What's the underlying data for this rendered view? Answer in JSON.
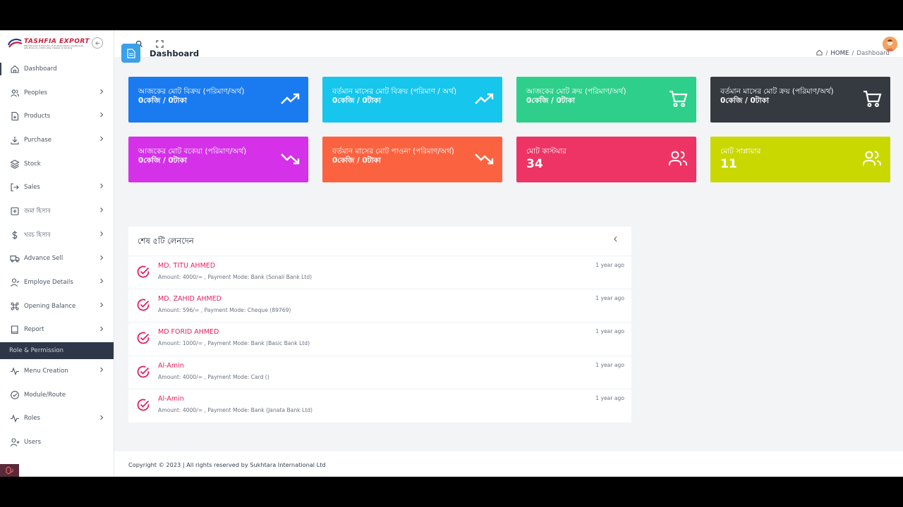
{
  "brand": {
    "name": "TASHFIA EXPORT",
    "tagline": "Manufacturer & Exporter of All Kinds Export Quality Jute, Jute Products, Cotton Jute, Hessian & Sacking"
  },
  "sidebar": {
    "items": [
      {
        "label": "Dashboard",
        "icon": "home-icon",
        "has_children": false,
        "active": true
      },
      {
        "label": "Peoples",
        "icon": "users-icon",
        "has_children": true
      },
      {
        "label": "Products",
        "icon": "file-plus-icon",
        "has_children": true
      },
      {
        "label": "Purchase",
        "icon": "download-icon",
        "has_children": true
      },
      {
        "label": "Stock",
        "icon": "layers-icon",
        "has_children": false
      },
      {
        "label": "Sales",
        "icon": "log-out-icon",
        "has_children": true
      },
      {
        "label": "জমা হিসাব",
        "icon": "plus-square-icon",
        "has_children": true
      },
      {
        "label": "খরচ হিসাব",
        "icon": "dollar-icon",
        "has_children": true
      },
      {
        "label": "Advance Sell",
        "icon": "truck-icon",
        "has_children": true
      },
      {
        "label": "Employe Details",
        "icon": "user-icon",
        "has_children": true
      },
      {
        "label": "Opening Balance",
        "icon": "command-icon",
        "has_children": true
      },
      {
        "label": "Report",
        "icon": "book-icon",
        "has_children": true
      }
    ],
    "section_header": "Role & Permission",
    "items2": [
      {
        "label": "Menu Creation",
        "icon": "activity-icon",
        "has_children": true
      },
      {
        "label": "Module/Route",
        "icon": "check-circle-icon",
        "has_children": false
      },
      {
        "label": "Roles",
        "icon": "activity-icon",
        "has_children": true
      },
      {
        "label": "Users",
        "icon": "user-plus-icon",
        "has_children": false
      }
    ]
  },
  "header": {
    "title": "Dashboard"
  },
  "breadcrumb": {
    "home": "HOME",
    "current": "Dashboard",
    "sep": "/"
  },
  "cards": [
    {
      "title": "আজকের মোট বিক্রয় (পরিমাণ/অর্থ)",
      "value": "0কেজি / 0টাকা",
      "color": "#1a7bf0",
      "icon": "trending-up-icon"
    },
    {
      "title": "বর্তমান মাসের মোট বিক্রয় (পরিমাণ / অর্থ)",
      "value": "0কেজি / 0টাকা",
      "color": "#16c6ec",
      "icon": "trending-up-icon"
    },
    {
      "title": "আজকের মোট ক্রয় (পরিমাণ/অর্থ)",
      "value": "0কেজি / 0টাকা",
      "color": "#2ecf8a",
      "icon": "cart-icon"
    },
    {
      "title": "বর্তমান মাসের মোট ক্রয় (পরিমাণ/অর্থ)",
      "value": "0কেজি / 0টাকা",
      "color": "#343a40",
      "icon": "cart-icon"
    },
    {
      "title": "আজকের মোট বকেয়া (পরিমাণ/অর্থ)",
      "value": "0কেজি / 0টাকা",
      "color": "#d431e8",
      "icon": "trending-down-icon"
    },
    {
      "title": "বর্তমান মাসের মোট পাওনা (পরিমাণ/অর্থ)",
      "value": "0কেজি / 0টাকা",
      "color": "#fb6340",
      "icon": "trending-down-icon"
    },
    {
      "title": "মোট কাস্টমার",
      "value": "34",
      "color": "#ee3464",
      "icon": "users-icon"
    },
    {
      "title": "মোট সাপ্লায়ার",
      "value": "11",
      "color": "#c9d800",
      "icon": "users-icon"
    }
  ],
  "recent": {
    "title": "শেষ ৫টি লেনদেন",
    "items": [
      {
        "name": "MD. TITU AHMED",
        "detail": "Amount: 4000/= , Payment Mode: Bank (Sonali Bank Ltd)",
        "time": "1 year ago"
      },
      {
        "name": "MD. ZAHID AHMED",
        "detail": "Amount: 596/= , Payment Mode: Cheque (89769)",
        "time": "1 year ago"
      },
      {
        "name": "MD FORID AHMED",
        "detail": "Amount: 1000/= , Payment Mode: Bank (Basic Bank Ltd)",
        "time": "1 year ago"
      },
      {
        "name": "Al-Amin",
        "detail": "Amount: 4000/= , Payment Mode: Card ()",
        "time": "1 year ago"
      },
      {
        "name": "Al-Amin",
        "detail": "Amount: 4000/= , Payment Mode: Bank (Janata Bank Ltd)",
        "time": "1 year ago"
      }
    ]
  },
  "footer": {
    "text": "Copyright © 2023 | All rights reserved by Sukhtara International Ltd"
  }
}
